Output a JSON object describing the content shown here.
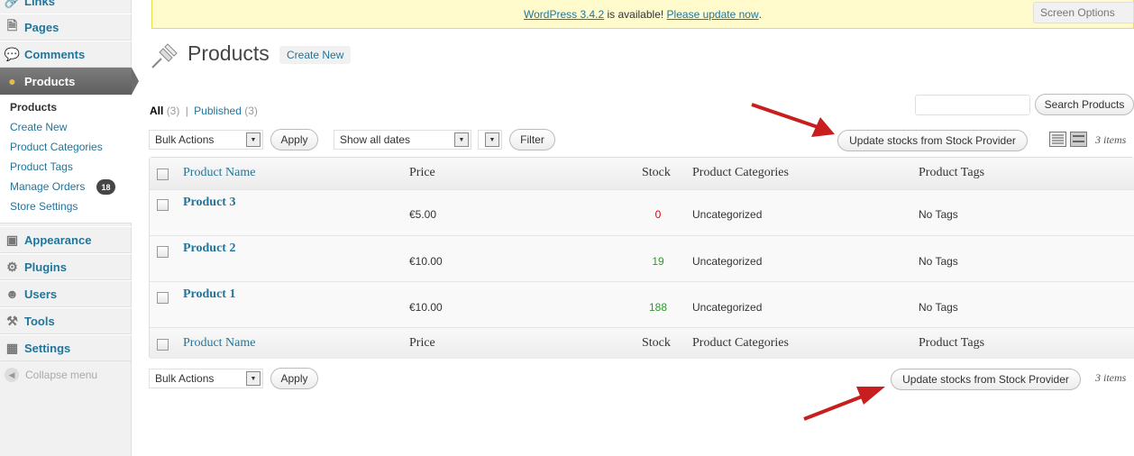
{
  "sidebar": {
    "items": [
      {
        "label": "Links",
        "icon": "links-icon"
      },
      {
        "label": "Pages",
        "icon": "pages-icon"
      },
      {
        "label": "Comments",
        "icon": "comments-icon"
      },
      {
        "label": "Products",
        "icon": "products-icon"
      },
      {
        "label": "Appearance",
        "icon": "appearance-icon"
      },
      {
        "label": "Plugins",
        "icon": "plugins-icon"
      },
      {
        "label": "Users",
        "icon": "users-icon"
      },
      {
        "label": "Tools",
        "icon": "tools-icon"
      },
      {
        "label": "Settings",
        "icon": "settings-icon"
      }
    ],
    "submenu": [
      "Products",
      "Create New",
      "Product Categories",
      "Product Tags",
      "Manage Orders",
      "Store Settings"
    ],
    "orders_badge": "18",
    "collapse_label": "Collapse menu"
  },
  "notice": {
    "version_link": "WordPress 3.4.2",
    "middle": " is available! ",
    "update_link": "Please update now",
    "end": "."
  },
  "screen_options": "Screen Options",
  "header": {
    "title": "Products",
    "create_new": "Create New"
  },
  "filters": {
    "all_label": "All",
    "all_count": "(3)",
    "separator": "|",
    "published_label": "Published",
    "published_count": "(3)"
  },
  "search": {
    "value": "",
    "button": "Search Products"
  },
  "toolbar": {
    "bulk_actions": "Bulk Actions",
    "apply": "Apply",
    "dates": "Show all dates",
    "filter": "Filter",
    "update_stocks": "Update stocks from Stock Provider",
    "items": "3 items"
  },
  "table": {
    "columns": [
      "Product Name",
      "Price",
      "Stock",
      "Product Categories",
      "Product Tags"
    ],
    "rows": [
      {
        "name": "Product 3",
        "price": "€5.00",
        "stock": "0",
        "stock_color": "#dd0000",
        "category": "Uncategorized",
        "tags": "No Tags"
      },
      {
        "name": "Product 2",
        "price": "€10.00",
        "stock": "19",
        "stock_color": "#2a9a2a",
        "category": "Uncategorized",
        "tags": "No Tags"
      },
      {
        "name": "Product 1",
        "price": "€10.00",
        "stock": "188",
        "stock_color": "#2a9a2a",
        "category": "Uncategorized",
        "tags": "No Tags"
      }
    ]
  },
  "colors": {
    "link": "#21759b",
    "annotation_arrow": "#c81e1e"
  }
}
